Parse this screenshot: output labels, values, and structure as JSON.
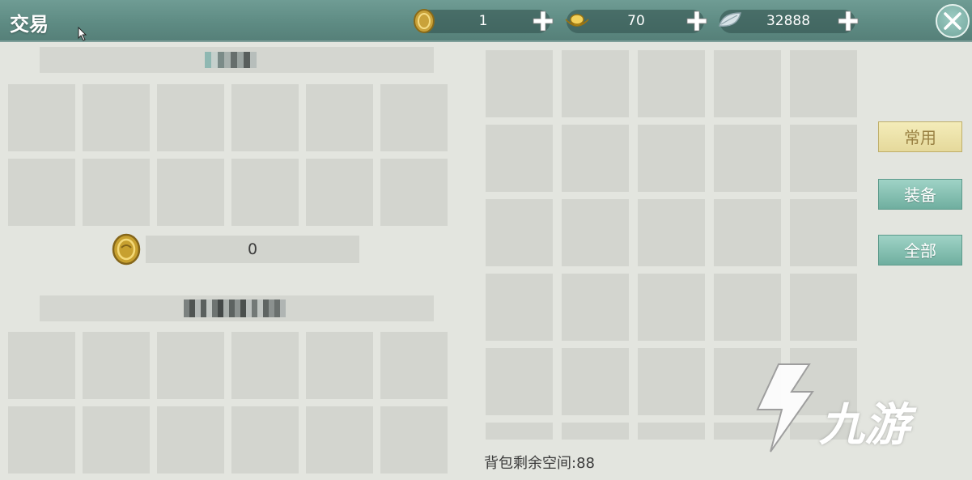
{
  "header": {
    "title": "交易",
    "currencies": [
      {
        "icon": "copper-coin-icon",
        "value": "1"
      },
      {
        "icon": "gold-ingot-icon",
        "value": "70"
      },
      {
        "icon": "silver-leaf-icon",
        "value": "32888"
      }
    ]
  },
  "trade": {
    "coin_offer": "0"
  },
  "inventory": {
    "tabs": [
      {
        "label": "常用",
        "active": true
      },
      {
        "label": "装备",
        "active": false
      },
      {
        "label": "全部",
        "active": false
      }
    ],
    "space_remaining": "背包剩余空间:88"
  },
  "watermark": {
    "text": "九游"
  },
  "colors": {
    "header": "#5e8b83",
    "slot": "#d3d5cf",
    "active_tab": "#e5d99b",
    "tab": "#6fae9f"
  }
}
